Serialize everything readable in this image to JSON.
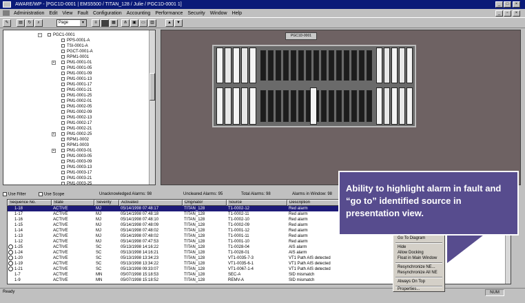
{
  "window": {
    "title": "AWARE/WP - [PGC1D-0001 | EMS5500 / TITAN_128 / Julie / PGC1D-0001 1]",
    "min": "_",
    "max": "□",
    "close": "×"
  },
  "menu": [
    "Administration",
    "Edit",
    "View",
    "Fault",
    "Configuration",
    "Accounting",
    "Performance",
    "Security",
    "Window",
    "Help"
  ],
  "toolbar": {
    "page_select": "Page"
  },
  "tree": {
    "items": [
      {
        "label": "PGC1-0001",
        "indent": 0,
        "expand": "−"
      },
      {
        "label": "PPS-0001-A",
        "indent": 1
      },
      {
        "label": "TSI-0001-A",
        "indent": 1
      },
      {
        "label": "PGCT-0001-A",
        "indent": 1
      },
      {
        "label": "RPM1-0001",
        "indent": 1
      },
      {
        "label": "PM1-0001-01",
        "indent": 1,
        "expand": "+"
      },
      {
        "label": "PM1-0001-05",
        "indent": 1
      },
      {
        "label": "PM1-0001-09",
        "indent": 1
      },
      {
        "label": "PM1-0001-13",
        "indent": 1
      },
      {
        "label": "PM1-0001-17",
        "indent": 1
      },
      {
        "label": "PM1-0001-21",
        "indent": 1
      },
      {
        "label": "PM1-0001-25",
        "indent": 1
      },
      {
        "label": "PM1-0002-01",
        "indent": 1
      },
      {
        "label": "PM1-0002-05",
        "indent": 1
      },
      {
        "label": "PM1-0002-09",
        "indent": 1
      },
      {
        "label": "PM1-0002-13",
        "indent": 1
      },
      {
        "label": "PM1-0002-17",
        "indent": 1
      },
      {
        "label": "PM1-0002-21",
        "indent": 1
      },
      {
        "label": "PM1-0002-25",
        "indent": 1,
        "expand": "+"
      },
      {
        "label": "RPM1-0002",
        "indent": 1
      },
      {
        "label": "RPM1-0003",
        "indent": 1
      },
      {
        "label": "PM1-0003-01",
        "indent": 1,
        "expand": "+"
      },
      {
        "label": "PM1-0003-05",
        "indent": 1
      },
      {
        "label": "PM1-0003-09",
        "indent": 1
      },
      {
        "label": "PM1-0003-13",
        "indent": 1
      },
      {
        "label": "PM1-0003-17",
        "indent": 1
      },
      {
        "label": "PM1-0003-21",
        "indent": 1
      },
      {
        "label": "PM1-0003-25",
        "indent": 1
      }
    ]
  },
  "view": {
    "label": "PGC1D-0001"
  },
  "alarm_bar": {
    "use_filter": "Use Filter",
    "use_scope": "Use Scope",
    "unack": "Unacknowledged Alarms: 98",
    "uncleared": "Uncleared Alarms: 95",
    "total": "Total Alarms: 98",
    "in_window": "Alarms in Window: 98"
  },
  "alarm_table": {
    "headers": [
      "Sequence No.",
      "State",
      "Severity",
      "Activated",
      "Originator",
      "Source",
      "Description"
    ],
    "rows": [
      {
        "seq": "1-18",
        "state": "ACTIVE",
        "sev": "MJ",
        "act": "05/14/1998 07:48:17",
        "orig": "TITAN_128",
        "src": "T1-0002-12",
        "desc": "Red alarm",
        "selected": true
      },
      {
        "seq": "1-17",
        "state": "ACTIVE",
        "sev": "MJ",
        "act": "05/14/1998 07:48:18",
        "orig": "TITAN_128",
        "src": "T1-0002-11",
        "desc": "Red alarm"
      },
      {
        "seq": "1-16",
        "state": "ACTIVE",
        "sev": "MJ",
        "act": "05/14/1998 07:48:10",
        "orig": "TITAN_128",
        "src": "T1-0002-10",
        "desc": "Red alarm"
      },
      {
        "seq": "1-15",
        "state": "ACTIVE",
        "sev": "MJ",
        "act": "05/14/1998 07:48:09",
        "orig": "TITAN_128",
        "src": "T1-0002-09",
        "desc": "Red alarm"
      },
      {
        "seq": "1-14",
        "state": "ACTIVE",
        "sev": "MJ",
        "act": "05/14/1998 07:48:02",
        "orig": "TITAN_128",
        "src": "T1-0001-12",
        "desc": "Red alarm"
      },
      {
        "seq": "1-13",
        "state": "ACTIVE",
        "sev": "MJ",
        "act": "05/14/1998 07:48:02",
        "orig": "TITAN_128",
        "src": "T1-0001-11",
        "desc": "Red alarm"
      },
      {
        "seq": "1-12",
        "state": "ACTIVE",
        "sev": "MJ",
        "act": "05/14/1998 07:47:53",
        "orig": "TITAN_128",
        "src": "T1-0001-10",
        "desc": "Red alarm"
      },
      {
        "seq": "1-25",
        "state": "ACTIVE",
        "sev": "SC",
        "act": "05/13/1998 14:16:22",
        "orig": "TITAN_128",
        "src": "T1-0028-04",
        "desc": "AIS alarm",
        "icon": true
      },
      {
        "seq": "1-24",
        "state": "ACTIVE",
        "sev": "SC",
        "act": "05/13/1998 14:16:21",
        "orig": "TITAN_128",
        "src": "T1-0028-01",
        "desc": "AIS alarm",
        "icon": true
      },
      {
        "seq": "1-20",
        "state": "ACTIVE",
        "sev": "SC",
        "act": "05/13/1998 13:34:23",
        "orig": "TITAN_128",
        "src": "VT1-0035-7-3",
        "desc": "VT1 Path AIS detected",
        "icon": true
      },
      {
        "seq": "1-19",
        "state": "ACTIVE",
        "sev": "SC",
        "act": "05/13/1998 13:34:22",
        "orig": "TITAN_128",
        "src": "VT1-0035-6-1",
        "desc": "VT1 Path AIS detected",
        "icon": true
      },
      {
        "seq": "1-21",
        "state": "ACTIVE",
        "sev": "SC",
        "act": "05/13/1998 09:33:07",
        "orig": "TITAN_128",
        "src": "VT1-0067-1-4",
        "desc": "VT1 Path AIS detected",
        "icon": true
      },
      {
        "seq": "1-7",
        "state": "ACTIVE",
        "sev": "MN",
        "act": "05/07/1998 15:18:53",
        "orig": "TITAN_128",
        "src": "SEC-A",
        "desc": "SID mismatch"
      },
      {
        "seq": "1-9",
        "state": "ACTIVE",
        "sev": "MN",
        "act": "05/07/1998 15:18:52",
        "orig": "TITAN_128",
        "src": "REMV-A",
        "desc": "SID mismatch"
      }
    ]
  },
  "context_menu": {
    "items": [
      "Go To Diagram",
      "Hide",
      "Allow Docking",
      "Float in Main Window",
      "Resynchronize NE...",
      "Resynchronize All NE",
      "Always On Top",
      "Properties..."
    ]
  },
  "status": {
    "left": "Ready",
    "num": "NUM"
  },
  "callout": {
    "text": "Ability to highlight alarm in fault and “go to” identified source in presentation view."
  },
  "colors": {
    "titlebar": "#0a1a78",
    "callout": "#574c8e",
    "selection": "#1d1a78"
  }
}
